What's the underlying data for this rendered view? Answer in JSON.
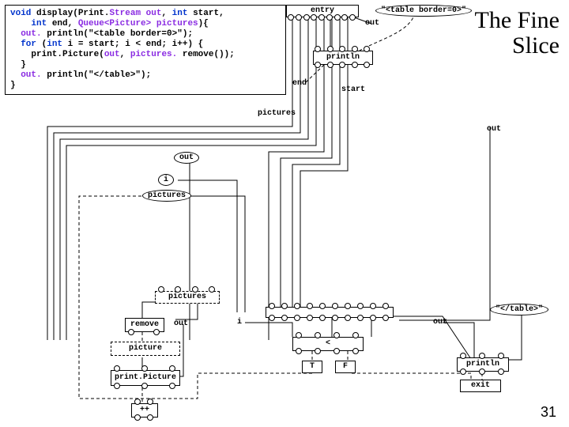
{
  "slide": {
    "title_line1": "The Fine",
    "title_line2": "Slice",
    "page": "31"
  },
  "code": {
    "l1": {
      "k1": "void",
      "t1": " display(Print.",
      "o1": "Stream out",
      "t2": ", ",
      "k2": "int",
      "t3": " start,"
    },
    "l2": {
      "t1": "    ",
      "k1": "int",
      "t2": " end, ",
      "o1": "Queue<Picture> pictures",
      "t3": "){"
    },
    "l3": {
      "t1": "  ",
      "o1": "out.",
      "t2": " println(\"<table border=0>\");"
    },
    "l4": {
      "t1": "  ",
      "k1": "for",
      "t2": " (",
      "k2": "int",
      "t3": " i = start; i < end; i++) {"
    },
    "l5": {
      "t1": "    print.Picture(",
      "o1": "out",
      "t2": ", ",
      "o2": "pictures.",
      "t3": " remove());"
    },
    "l6": "  }",
    "l7": {
      "t1": "  ",
      "o1": "out.",
      "t2": " println(\"</table>\");"
    },
    "l8": "}"
  },
  "graph": {
    "entry": "entry",
    "out": "out",
    "println": "println",
    "end": "end",
    "start": "start",
    "pictures": "pictures",
    "i": "i",
    "remove": "remove",
    "picture": "picture",
    "printPicture": "print.Picture",
    "lt": "<",
    "T": "T",
    "F": "F",
    "exit": "exit",
    "inc": "++",
    "lit_open": "\"<table border=0>\"",
    "lit_close": "\"</table>\""
  }
}
